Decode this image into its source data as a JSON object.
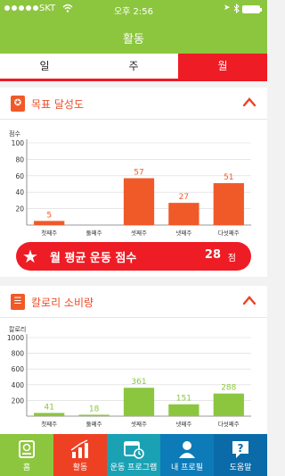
{
  "status": {
    "carrier": "SKT",
    "time": "오후 2:56"
  },
  "nav": {
    "title": "활동"
  },
  "tabs": [
    {
      "label": "일"
    },
    {
      "label": "주"
    },
    {
      "label": "월"
    }
  ],
  "goal_card": {
    "title": "목표 달성도",
    "y_unit": "점수"
  },
  "calorie_card": {
    "title": "칼로리 소비량",
    "y_unit": "칼로리"
  },
  "monthly_avg": {
    "label": "월 평균 운동 점수",
    "value": "28",
    "unit": "점"
  },
  "bottom_nav": [
    {
      "label": "홈",
      "icon": "home-badge-icon"
    },
    {
      "label": "활동",
      "icon": "bar-chart-icon"
    },
    {
      "label": "운동 프로그램",
      "icon": "calendar-clock-icon"
    },
    {
      "label": "내 프로필",
      "icon": "person-icon"
    },
    {
      "label": "도움말",
      "icon": "question-icon"
    }
  ],
  "colors": {
    "header": "#8cc63f",
    "accent": "#ee1c25",
    "goal_bar": "#f05a28",
    "calorie_bar": "#8cc63f"
  },
  "chart_data": [
    {
      "type": "bar",
      "ylabel": "점수",
      "categories": [
        "첫째주",
        "둘째주",
        "셋째주",
        "넷째주",
        "다섯째주"
      ],
      "values": [
        5,
        0,
        57,
        27,
        51
      ],
      "value_labels": [
        "5",
        "",
        "57",
        "27",
        "51"
      ],
      "yticks": [
        "100",
        "80",
        "60",
        "40",
        "20"
      ],
      "ylim": [
        0,
        100
      ],
      "grid": true
    },
    {
      "type": "bar",
      "ylabel": "칼로리",
      "categories": [
        "첫째주",
        "둘째주",
        "셋째주",
        "넷째주",
        "다섯째주"
      ],
      "values": [
        41,
        18,
        361,
        151,
        288
      ],
      "value_labels": [
        "41",
        "18",
        "361",
        "151",
        "288"
      ],
      "yticks": [
        "1000",
        "800",
        "600",
        "400",
        "200"
      ],
      "ylim": [
        0,
        1000
      ],
      "grid": true
    }
  ]
}
